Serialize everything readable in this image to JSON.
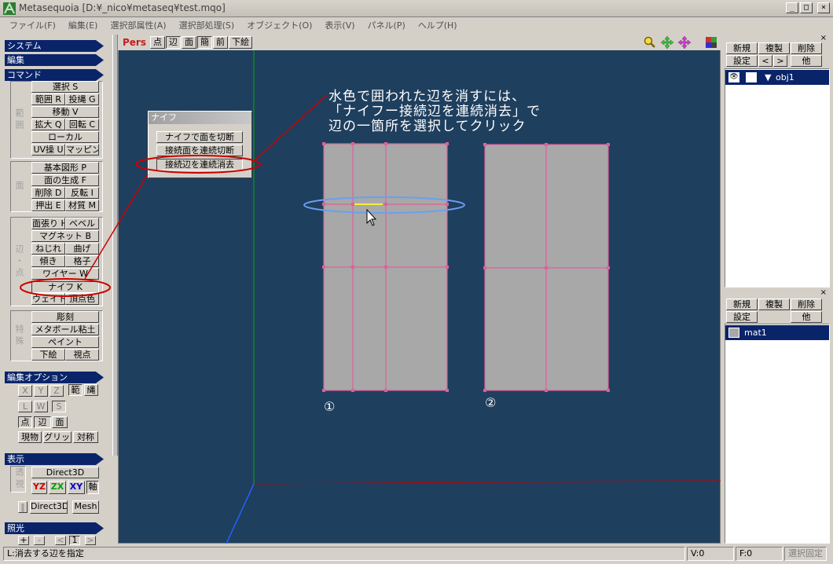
{
  "window": {
    "title": "Metasequoia [D:¥_nico¥metaseq¥test.mqo]",
    "controls": [
      "_",
      "□",
      "×"
    ]
  },
  "menu": [
    "ファイル(F)",
    "編集(E)",
    "選択部属性(A)",
    "選択部処理(S)",
    "オブジェクト(O)",
    "表示(V)",
    "パネル(P)",
    "ヘルプ(H)"
  ],
  "left": {
    "headers": {
      "system": "システム",
      "edit": "編集",
      "command": "コマンド",
      "edit_option": "編集オプション",
      "display": "表示",
      "light": "照光"
    },
    "group_labels": {
      "range": "範囲",
      "face": "面",
      "edge": "辺・点",
      "special": "特殊",
      "transparent": "透視"
    },
    "buttons": {
      "select": "選択 S",
      "range": "範囲 R",
      "lasso": "投縄 G",
      "move": "移動 V",
      "scale": "拡大 Q",
      "rotate": "回転 C",
      "local": "ローカル",
      "uv": "UV操 U",
      "mapping": "マッピング",
      "primitive": "基本図形 P",
      "create_face": "面の生成 F",
      "delete": "削除 D",
      "invert": "反転 I",
      "extrude": "押出 E",
      "material": "材質 M",
      "stretch": "面張り H",
      "bevel": "ベベル",
      "magnet": "マグネット B",
      "twist": "ねじれ",
      "bend": "曲げ",
      "tilt": "傾き",
      "lattice": "格子",
      "wire": "ワイヤー W",
      "knife": "ナイフ K",
      "weight": "ウェイト",
      "vertex_color": "頂点色",
      "sculpt": "彫刻",
      "metaball": "メタボール粘土",
      "paint": "ペイント",
      "underlay": "下絵",
      "view": "視点"
    },
    "options": {
      "x": "X",
      "y": "Y",
      "z": "Z",
      "range": "範",
      "lasso": "縄",
      "l": "L",
      "w": "W",
      "s": "S",
      "point": "点",
      "edge": "辺",
      "face": "面",
      "real": "現物",
      "grid": "グリッド",
      "symmetry": "対称"
    },
    "display": {
      "direct3d_top": "Direct3D",
      "yz": "YZ",
      "zx": "ZX",
      "xy": "XY",
      "axis": "軸",
      "direct3d": "Direct3D",
      "mesh": "Mesh"
    },
    "light_buttons": [
      "+",
      "-",
      "<",
      "1",
      ">"
    ]
  },
  "viewport": {
    "mode": "Pers",
    "buttons": [
      "点",
      "辺",
      "面",
      "簡",
      "前",
      "下絵"
    ],
    "annotation": "水色で囲われた辺を消すには、\n「ナイフー接続辺を連続消去」で\n辺の一箇所を選択してクリック",
    "label_1": "①",
    "label_2": "②"
  },
  "knife_dialog": {
    "title": "ナイフ",
    "buttons": [
      "ナイフで面を切断",
      "接続面を連続切断",
      "接続辺を連続消去"
    ]
  },
  "object_panel": {
    "buttons": [
      "新規",
      "複製",
      "削除",
      "設定",
      "<",
      ">",
      "他"
    ],
    "item": "obj1"
  },
  "material_panel": {
    "buttons": [
      "新規",
      "複製",
      "削除",
      "設定",
      "他"
    ],
    "item": "mat1"
  },
  "status": {
    "hint": "L:消去する辺を指定",
    "v": "V:0",
    "f": "F:0",
    "lock": "選択固定"
  },
  "colors": {
    "viewport_bg": "#1f3f5e",
    "header_bg": "#0a246a",
    "mesh_face": "#a8a8a8",
    "mesh_edge": "#e0609a",
    "highlight_ring": "#6aa0f0",
    "annotation_red": "#cc0000"
  }
}
